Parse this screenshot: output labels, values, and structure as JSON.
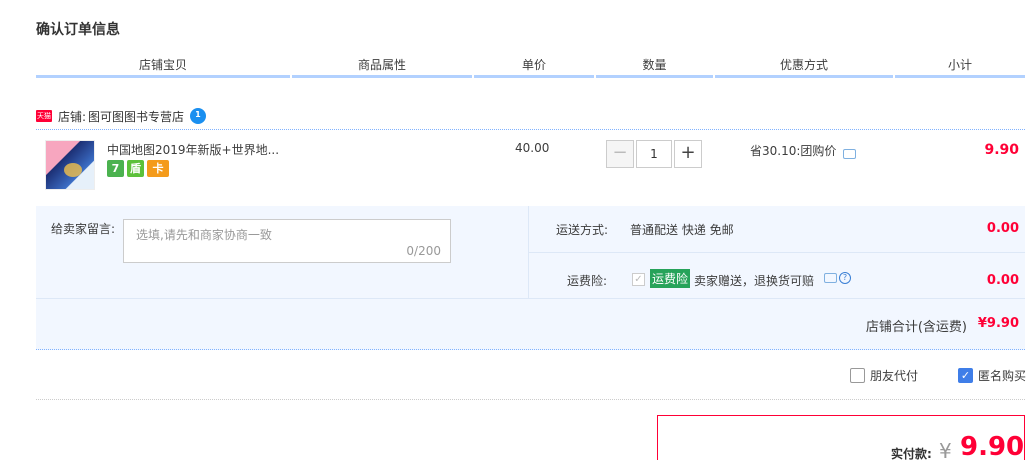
{
  "page_title": "确认订单信息",
  "columns": [
    "店铺宝贝",
    "商品属性",
    "单价",
    "数量",
    "优惠方式",
    "小计"
  ],
  "shop": {
    "platform_badge": "天猫",
    "label": "店铺:",
    "name": "图可图图书专营店"
  },
  "item": {
    "title": "中国地图2019年新版+世界地...",
    "badges": [
      "7",
      "盾",
      "卡"
    ],
    "unit_price": "40.00",
    "quantity": "1",
    "minus_label": "−",
    "plus_label": "+",
    "discount": "省30.10:团购价",
    "subtotal": "9.90"
  },
  "message": {
    "label": "给卖家留言:",
    "placeholder": "选填,请先和商家协商一致",
    "counter": "0/200"
  },
  "shipping": {
    "label": "运送方式:",
    "value": "普通配送 快递 免邮",
    "price": "0.00"
  },
  "insurance": {
    "label": "运费险:",
    "check": "✓",
    "tag": "运费险",
    "desc": "卖家赠送，退换货可赔",
    "help": "?",
    "price": "0.00"
  },
  "shop_total": {
    "label": "店铺合计(含运费)",
    "value": "¥9.90"
  },
  "options": {
    "friend_pay": "朋友代付",
    "anonymous": "匿名购买",
    "anon_check": "✓"
  },
  "payment": {
    "label": "实付款:",
    "currency": "¥",
    "value": "9.90"
  },
  "colors": {
    "accent_red": "#ff0036",
    "header_line": "#b2d1ff",
    "panel_bg": "#f2f7ff",
    "checkbox_blue": "#3f7ee8"
  }
}
